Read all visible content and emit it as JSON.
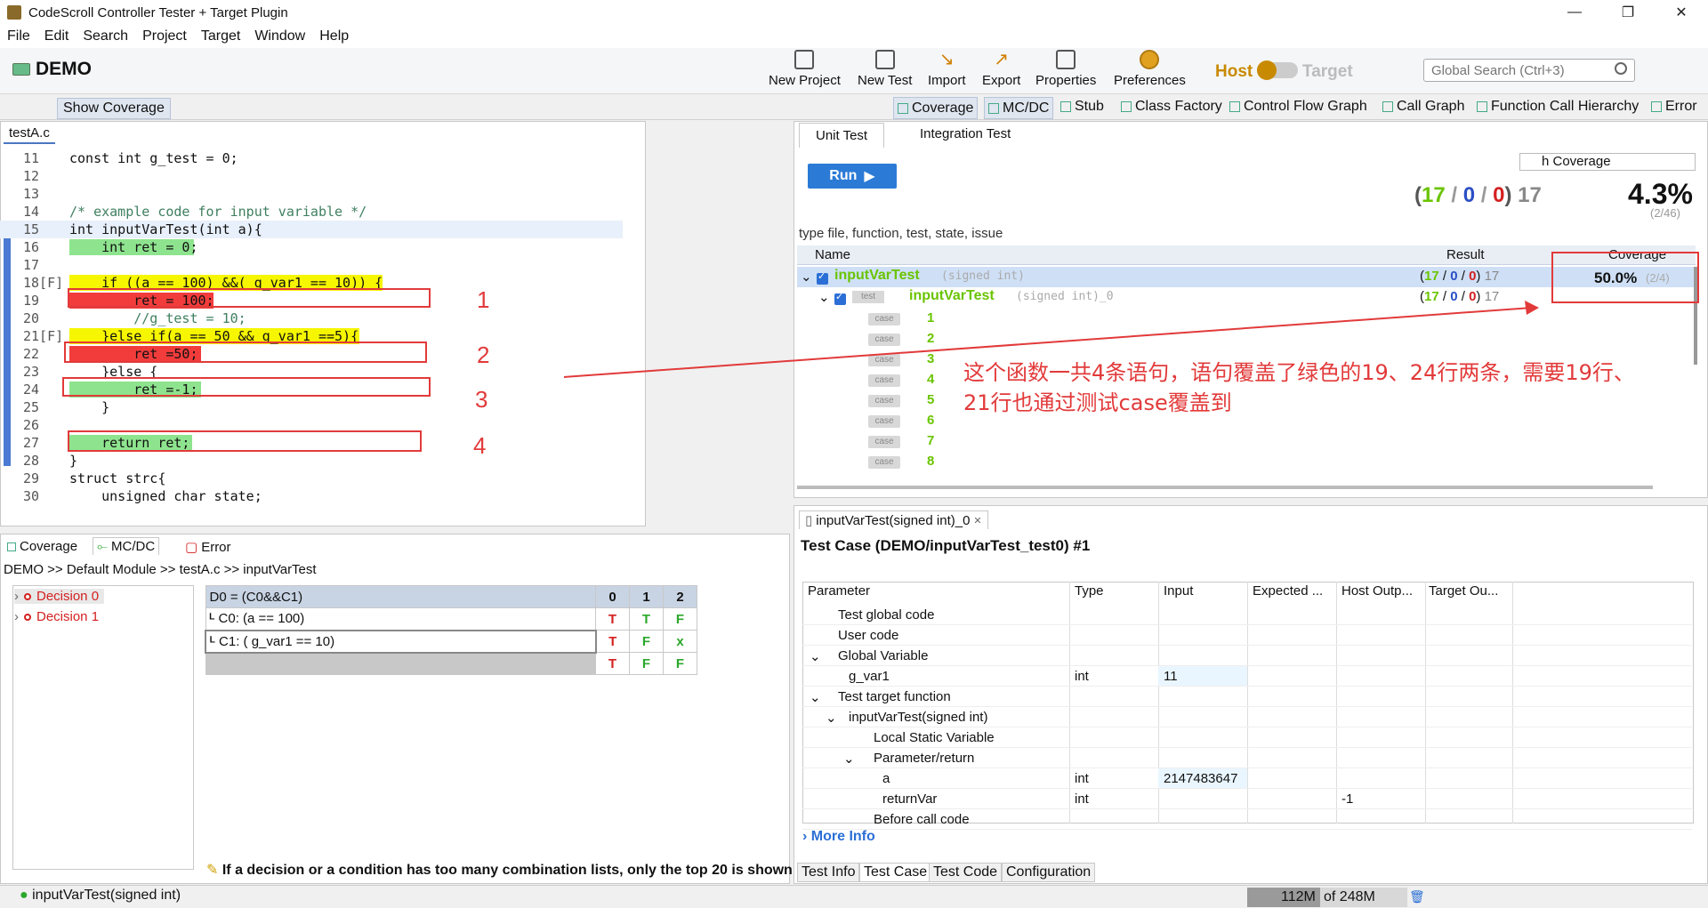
{
  "window": {
    "title": "CodeScroll Controller Tester + Target Plugin",
    "minimize": "—",
    "restore": "❐",
    "close": "✕"
  },
  "menu": [
    "File",
    "Edit",
    "Search",
    "Project",
    "Target",
    "Window",
    "Help"
  ],
  "toolbar": {
    "project": "DEMO",
    "buttons": [
      "New Project",
      "New Test",
      "Import",
      "Export",
      "Properties",
      "Preferences"
    ],
    "host": "Host",
    "target": "Target",
    "search_placeholder": "Global Search (Ctrl+3)"
  },
  "viewbar": {
    "show_coverage": "Show Coverage",
    "tabs": [
      "Coverage",
      "MC/DC",
      "Stub",
      "Class Factory",
      "Control Flow Graph",
      "Call Graph",
      "Function Call Hierarchy",
      "Error"
    ]
  },
  "editor": {
    "tab": "testA.c",
    "lines": [
      {
        "n": "11",
        "code": "const int g_test = 0;"
      },
      {
        "n": "12",
        "code": ""
      },
      {
        "n": "13",
        "code": ""
      },
      {
        "n": "14",
        "code": "/* example code for input variable */"
      },
      {
        "n": "15",
        "code": "int inputVarTest(int a){"
      },
      {
        "n": "16",
        "code": "    int ret = 0;"
      },
      {
        "n": "17",
        "code": ""
      },
      {
        "n": "18[F]",
        "code": "    if ((a == 100) &&( g_var1 == 10)) {"
      },
      {
        "n": "19",
        "code": "        ret = 100;"
      },
      {
        "n": "20",
        "code": "        //g_test = 10;"
      },
      {
        "n": "21[F]",
        "code": "    }else if(a == 50 && g_var1 ==5){"
      },
      {
        "n": "22",
        "code": "        ret =50;"
      },
      {
        "n": "23",
        "code": "    }else {"
      },
      {
        "n": "24",
        "code": "        ret =-1;"
      },
      {
        "n": "25",
        "code": "    }"
      },
      {
        "n": "26",
        "code": ""
      },
      {
        "n": "27",
        "code": "    return ret;"
      },
      {
        "n": "28",
        "code": "}"
      },
      {
        "n": "29",
        "code": "struct strc{"
      },
      {
        "n": "30",
        "code": "    unsigned char state;"
      }
    ],
    "annotations": [
      "1",
      "2",
      "3",
      "4"
    ]
  },
  "unittest": {
    "tabs": [
      "Unit Test",
      "Integration Test"
    ],
    "run": "Run",
    "coverage_select": "h Coverage",
    "stat_g": "17",
    "stat_b": "0",
    "stat_r": "0",
    "stat_total": "17",
    "coverage_big": "4.3%",
    "coverage_small": "(2/46)",
    "filter": "type file, function, test, state, issue",
    "columns": [
      "Name",
      "Result",
      "Coverage"
    ],
    "function": {
      "name": "inputVarTest",
      "sig": "(signed int)",
      "g": "17",
      "b": "0",
      "r": "0",
      "total": "17",
      "coverage": "50.0%",
      "coverage_detail": "(2/4)"
    },
    "test": {
      "tag": "test",
      "name": "inputVarTest",
      "sig": "(signed int)_0",
      "g": "17",
      "b": "0",
      "r": "0",
      "total": "17"
    },
    "case_tag": "case",
    "cases": [
      "1",
      "2",
      "3",
      "4",
      "5",
      "6",
      "7",
      "8"
    ],
    "note": "这个函数一共4条语句，语句覆盖了绿色的19、24行两条，需要19行、21行也通过测试case覆盖到"
  },
  "mcdc": {
    "tabs": [
      "Coverage",
      "MC/DC",
      "Error"
    ],
    "breadcrumb": "DEMO >> Default Module >> testA.c >> inputVarTest",
    "decisions": [
      "Decision 0",
      "Decision 1"
    ],
    "table": {
      "header": "D0 = (C0&&C1)",
      "cols": [
        "0",
        "1",
        "2"
      ],
      "rows": [
        {
          "label": "C0: (a == 100)",
          "vals": [
            "T",
            "T",
            "F"
          ]
        },
        {
          "label": "C1: ( g_var1 == 10)",
          "vals": [
            "T",
            "F",
            "x"
          ]
        },
        {
          "label": "",
          "vals": [
            "T",
            "F",
            "F"
          ]
        }
      ]
    },
    "note": "If a decision or a condition has too many combination lists, only the top 20 is shown"
  },
  "testcase": {
    "tab": "inputVarTest(signed int)_0",
    "title": "Test Case (DEMO/inputVarTest_test0) #1",
    "columns": [
      "Parameter",
      "Type",
      "Input",
      "Expected ...",
      "Host Outp...",
      "Target Ou..."
    ],
    "rows": [
      {
        "param": "Test global code",
        "type": "",
        "input": "",
        "host": ""
      },
      {
        "param": "User code",
        "type": "",
        "input": "",
        "host": ""
      },
      {
        "param": "Global Variable",
        "type": "",
        "input": "",
        "host": ""
      },
      {
        "param": "g_var1",
        "type": "int",
        "input": "11",
        "host": ""
      },
      {
        "param": "Test target function",
        "type": "",
        "input": "",
        "host": ""
      },
      {
        "param": "inputVarTest(signed int)",
        "type": "",
        "input": "",
        "host": ""
      },
      {
        "param": "Local Static Variable",
        "type": "",
        "input": "",
        "host": ""
      },
      {
        "param": "Parameter/return",
        "type": "",
        "input": "",
        "host": ""
      },
      {
        "param": "a",
        "type": "int",
        "input": "2147483647",
        "host": ""
      },
      {
        "param": "returnVar",
        "type": "int",
        "input": "",
        "host": "-1"
      },
      {
        "param": "Before call code",
        "type": "",
        "input": "",
        "host": ""
      }
    ],
    "more_info": "More Info",
    "bottom_tabs": [
      "Test Info",
      "Test Case",
      "Test Code",
      "Configuration"
    ]
  },
  "status": {
    "text": "inputVarTest(signed int)",
    "heap_used": "112M",
    "heap_total": "of 248M"
  }
}
